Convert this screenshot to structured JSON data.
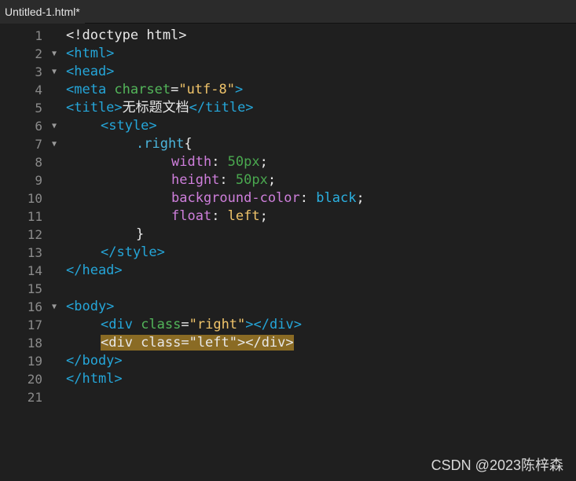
{
  "window": {
    "tab_title": "Untitled-1.html*"
  },
  "gutter": {
    "line_numbers": [
      "1",
      "2",
      "3",
      "4",
      "5",
      "6",
      "7",
      "8",
      "9",
      "10",
      "11",
      "12",
      "13",
      "14",
      "15",
      "16",
      "17",
      "18",
      "19",
      "20",
      "21"
    ]
  },
  "fold_markers": [
    "▼",
    "▼",
    "▼",
    "▼",
    "▼"
  ],
  "code": {
    "l1": "<!doctype html>",
    "l2": "<html>",
    "l3": "<head>",
    "l4_tag": "<meta",
    "l4_attr": " charset",
    "l4_eq": "=",
    "l4_val": "\"utf-8\"",
    "l4_close": ">",
    "l5_open": "<title>",
    "l5_text": "无标题文档",
    "l5_close": "</title>",
    "l6": "<style>",
    "l7_sel": ".right",
    "l7_brace": "{",
    "l8_prop": "width",
    "l8_colon": ": ",
    "l8_val": "50px",
    "l8_semi": ";",
    "l9_prop": "height",
    "l9_colon": ": ",
    "l9_val": "50px",
    "l9_semi": ";",
    "l10_prop": "background-color",
    "l10_colon": ": ",
    "l10_val": "black",
    "l10_semi": ";",
    "l11_prop": "float",
    "l11_colon": ": ",
    "l11_val": "left",
    "l11_semi": ";",
    "l12": "}",
    "l13": "</style>",
    "l14": "</head>",
    "l16": "<body>",
    "l17_tag": "<div",
    "l17_attr": " class",
    "l17_eq": "=",
    "l17_val": "\"right\"",
    "l17_close": "></div>",
    "l18": "<div class=\"left\"></div>",
    "l19": "</body>",
    "l20": "</html>"
  },
  "watermark": "CSDN @2023陈梓森",
  "colors": {
    "tag": "#25a6d9",
    "attribute": "#53b65a",
    "string": "#f0c46a",
    "property": "#cf7fdc",
    "highlight": "#8a6b24"
  }
}
